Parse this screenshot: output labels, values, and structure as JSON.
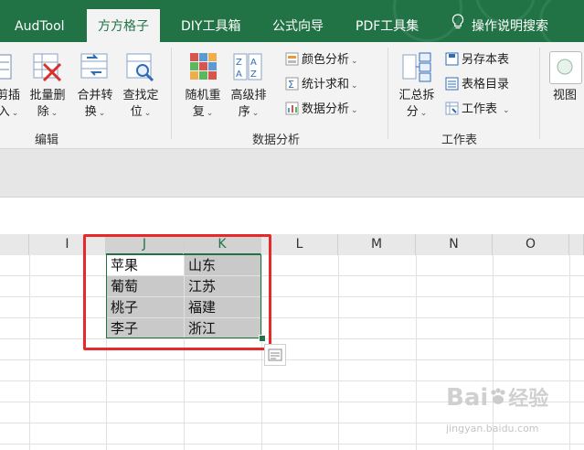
{
  "ribbon_tabs": [
    {
      "label": "AudTool"
    },
    {
      "label": "方方格子"
    },
    {
      "label": "DIY工具箱"
    },
    {
      "label": "公式向导"
    },
    {
      "label": "PDF工具集"
    }
  ],
  "tell_me": {
    "label": "操作说明搜索"
  },
  "groups": {
    "edit": {
      "label": "编辑",
      "buttons": [
        {
          "label": "剪插",
          "sub": "入"
        },
        {
          "label": "批量删",
          "sub": "除"
        },
        {
          "label": "合并转",
          "sub": "换"
        },
        {
          "label": "查找定",
          "sub": "位"
        }
      ]
    },
    "data_analysis": {
      "label": "数据分析",
      "buttons": [
        {
          "label": "随机重",
          "sub": "复"
        },
        {
          "label": "高级排",
          "sub": "序"
        }
      ],
      "small_items": [
        {
          "label": "颜色分析"
        },
        {
          "label": "统计求和"
        },
        {
          "label": "数据分析"
        }
      ]
    },
    "worksheet": {
      "label": "工作表",
      "buttons": [
        {
          "label": "汇总拆",
          "sub": "分"
        }
      ],
      "small_items": [
        {
          "label": "另存本表"
        },
        {
          "label": "表格目录"
        },
        {
          "label": "工作表"
        }
      ]
    },
    "view": {
      "buttons": [
        {
          "label": "视图"
        }
      ]
    }
  },
  "columns": [
    "I",
    "J",
    "K",
    "L",
    "M",
    "N",
    "O"
  ],
  "cells": [
    [
      "苹果",
      "山东"
    ],
    [
      "葡萄",
      "江苏"
    ],
    [
      "桃子",
      "福建"
    ],
    [
      "李子",
      "浙江"
    ]
  ],
  "watermark": {
    "brand": "Bai",
    "brand2": "经验",
    "url": "jingyan.baidu.com"
  },
  "colors": {
    "accent": "#217346",
    "highlight": "#e8292b",
    "selection_fill": "#c9c9c9"
  },
  "icons": [
    "lightbulb-icon",
    "quick-analysis-icon",
    "table-icon",
    "sort-icon",
    "random-icon",
    "find-icon",
    "view-icon"
  ]
}
